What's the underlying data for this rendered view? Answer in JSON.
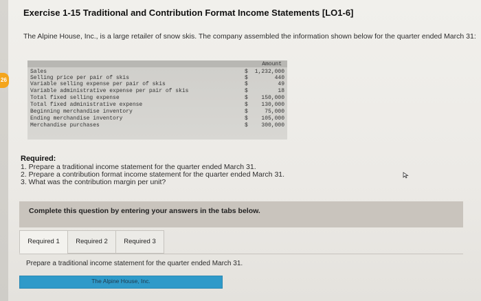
{
  "side_tab": {
    "label": "26"
  },
  "exercise": {
    "title": "Exercise 1-15 Traditional and Contribution Format Income Statements [LO1-6]",
    "intro": "The Alpine House, Inc., is a large retailer of snow skis. The company assembled the information shown below for the quarter ended March 31:"
  },
  "data_table": {
    "header": "Amount",
    "rows": [
      {
        "label": "Sales",
        "dollar": "$",
        "value": "1,232,000"
      },
      {
        "label": "Selling price per pair of skis",
        "dollar": "$",
        "value": "440"
      },
      {
        "label": "Variable selling expense per pair of skis",
        "dollar": "$",
        "value": "49"
      },
      {
        "label": "Variable administrative expense per pair of skis",
        "dollar": "$",
        "value": "18"
      },
      {
        "label": "Total fixed selling expense",
        "dollar": "$",
        "value": "150,000"
      },
      {
        "label": "Total fixed administrative expense",
        "dollar": "$",
        "value": "130,000"
      },
      {
        "label": "Beginning merchandise inventory",
        "dollar": "$",
        "value": "75,000"
      },
      {
        "label": "Ending merchandise inventory",
        "dollar": "$",
        "value": "105,000"
      },
      {
        "label": "Merchandise purchases",
        "dollar": "$",
        "value": "300,000"
      }
    ]
  },
  "required": {
    "heading": "Required:",
    "items": [
      "1. Prepare a traditional income statement for the quarter ended March 31.",
      "2. Prepare a contribution format income statement for the quarter ended March 31.",
      "3. What was the contribution margin per unit?"
    ]
  },
  "instructions": "Complete this question by entering your answers in the tabs below.",
  "tabs": [
    {
      "label": "Required 1",
      "active": true
    },
    {
      "label": "Required 2",
      "active": false
    },
    {
      "label": "Required 3",
      "active": false
    }
  ],
  "prepare_text": "Prepare a traditional income statement for the quarter ended March 31.",
  "company_name": "The Alpine House, Inc.",
  "colors": {
    "side_tab": "#f4a51c",
    "company_bar": "#2f9ac9",
    "instruction_box": "#c9c4bd"
  }
}
